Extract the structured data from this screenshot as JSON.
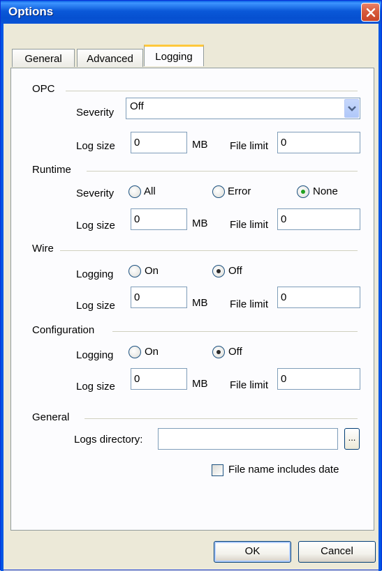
{
  "window": {
    "title": "Options"
  },
  "tabs": [
    {
      "label": "General",
      "active": false
    },
    {
      "label": "Advanced",
      "active": false
    },
    {
      "label": "Logging",
      "active": true
    }
  ],
  "opc": {
    "section_label": "OPC",
    "severity_label": "Severity",
    "severity_value": "Off",
    "log_size_label": "Log size",
    "log_size_value": "0",
    "unit": "MB",
    "file_limit_label": "File limit",
    "file_limit_value": "0"
  },
  "runtime": {
    "section_label": "Runtime",
    "severity_label": "Severity",
    "options": [
      "All",
      "Error",
      "None"
    ],
    "selected": "None",
    "log_size_label": "Log size",
    "log_size_value": "0",
    "unit": "MB",
    "file_limit_label": "File limit",
    "file_limit_value": "0"
  },
  "wire": {
    "section_label": "Wire",
    "logging_label": "Logging",
    "options": [
      "On",
      "Off"
    ],
    "selected": "Off",
    "log_size_label": "Log size",
    "log_size_value": "0",
    "unit": "MB",
    "file_limit_label": "File limit",
    "file_limit_value": "0"
  },
  "configuration": {
    "section_label": "Configuration",
    "logging_label": "Logging",
    "options": [
      "On",
      "Off"
    ],
    "selected": "Off",
    "log_size_label": "Log size",
    "log_size_value": "0",
    "unit": "MB",
    "file_limit_label": "File limit",
    "file_limit_value": "0"
  },
  "general": {
    "section_label": "General",
    "logs_directory_label": "Logs directory:",
    "logs_directory_value": "",
    "browse_label": "...",
    "file_name_date_label": "File name includes date",
    "file_name_date_checked": false
  },
  "footer": {
    "ok_label": "OK",
    "cancel_label": "Cancel"
  },
  "colors": {
    "title_bar": "#0a58d8",
    "tab_highlight": "#ffc83c",
    "close_button": "#d75b3d"
  }
}
